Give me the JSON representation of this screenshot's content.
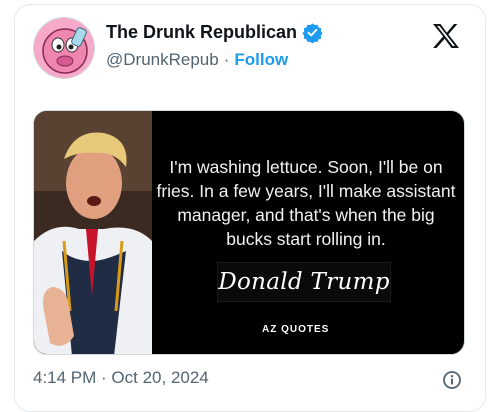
{
  "author": {
    "display_name": "The Drunk Republican",
    "handle": "@DrunkRepub",
    "separator": "·",
    "follow_label": "Follow",
    "verified": true
  },
  "media": {
    "quote": "I'm washing lettuce. Soon, I'll be on fries. In a few years, I'll make assistant manager, and that's when the big bucks start rolling in.",
    "signature": "Donald Trump",
    "source": "AZ QUOTES"
  },
  "timestamp": "4:14 PM · Oct 20, 2024",
  "icons": {
    "verified": "verified-badge-icon",
    "platform": "x-logo-icon",
    "info": "info-icon"
  },
  "colors": {
    "accent": "#1d9bf0",
    "secondary_text": "#536471",
    "avatar_bg": "#f4a6c6"
  }
}
